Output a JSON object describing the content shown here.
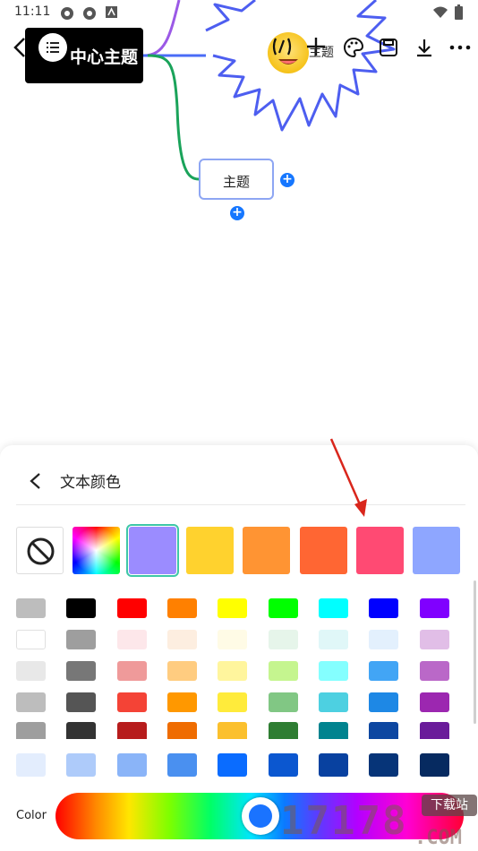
{
  "status_bar": {
    "time": "11:11"
  },
  "canvas": {
    "center_topic": "中心主题",
    "topic_node": "主题",
    "partial_topic": "主题"
  },
  "sheet": {
    "title": "文本颜色",
    "featured_swatches": [
      "#ffffff",
      "#9b8cff",
      "#ffd22e",
      "#ff9433",
      "#ff6633",
      "#ff4a73",
      "#8ea6ff"
    ],
    "grid_rows": [
      [
        "#bdbdbd",
        "#000000",
        "#ff0000",
        "#ff8000",
        "#ffff00",
        "#00ff00",
        "#00ffff",
        "#0000ff",
        "#8000ff"
      ],
      [
        "#ffffff",
        "#9e9e9e",
        "#fde7ea",
        "#fdeee0",
        "#fffbe6",
        "#e6f5ea",
        "#e0f7f8",
        "#e3f0fd",
        "#e1bee7"
      ],
      [
        "#e8e8e8",
        "#777777",
        "#ef9a9a",
        "#ffcc80",
        "#fff59d",
        "#c5f58f",
        "#84ffff",
        "#42a5f5",
        "#ba68c8"
      ],
      [
        "#bdbdbd",
        "#555555",
        "#f44336",
        "#ff9800",
        "#ffeb3b",
        "#81c784",
        "#4dd0e1",
        "#1e88e5",
        "#9c27b0"
      ],
      [
        "#9e9e9e",
        "#333333",
        "#b71c1c",
        "#ef6c00",
        "#fbc02d",
        "#2e7d32",
        "#00838f",
        "#0d47a1",
        "#6a1b9a"
      ]
    ],
    "blue_row": [
      "#e3edfd",
      "#aecbfa",
      "#8ab4f8",
      "#4a90f0",
      "#0a6cff",
      "#0b57d0",
      "#0841a0",
      "#063478",
      "#062a60"
    ],
    "color_label": "Color"
  },
  "watermark": {
    "text": "17178",
    "sub": "下载站",
    "domain": ".COM"
  }
}
